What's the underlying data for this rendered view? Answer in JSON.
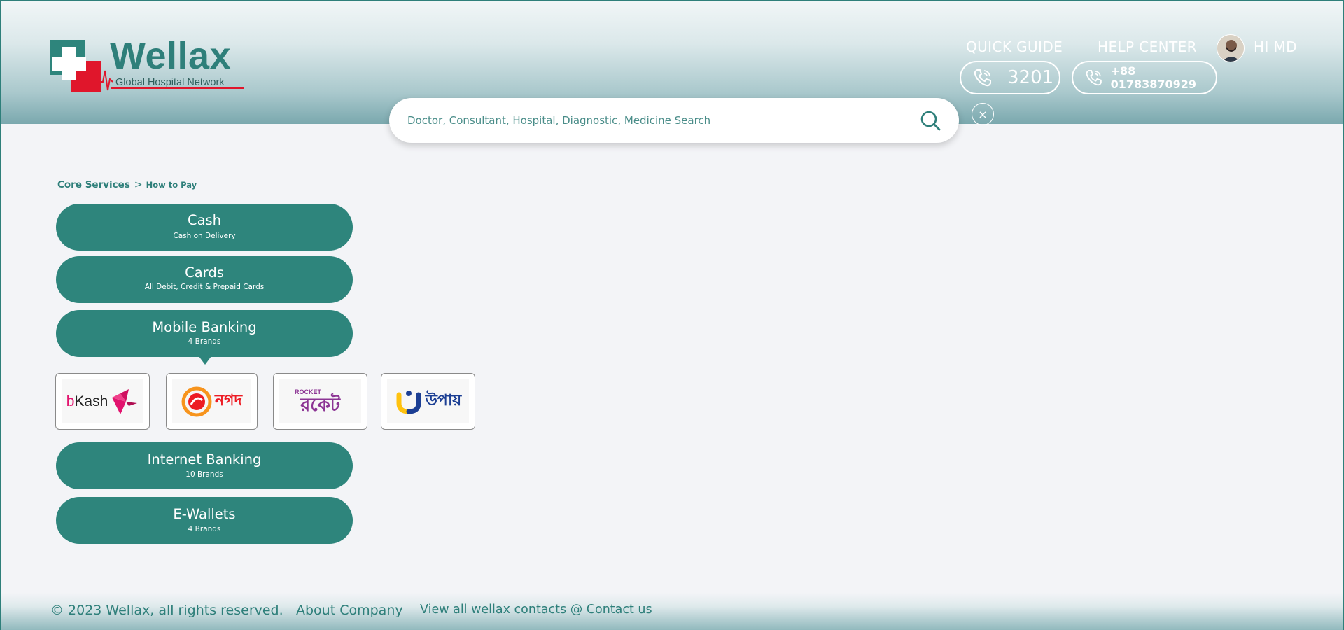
{
  "header": {
    "logo": {
      "name": "Wellax",
      "tagline": "Global Hospital Network"
    },
    "quick_guide": {
      "label": "QUICK GUIDE",
      "number": "3201"
    },
    "help_center": {
      "label": "HELP CENTER",
      "number": "+88 01783870929"
    },
    "user": {
      "greeting": "HI MD"
    },
    "search": {
      "placeholder": "Doctor, Consultant, Hospital, Diagnostic, Medicine Search",
      "value": "",
      "clear_label": "×"
    }
  },
  "breadcrumb": {
    "root": "Core Services",
    "separator": ">",
    "current": "How to Pay"
  },
  "payment_methods": [
    {
      "title": "Cash",
      "subtitle": "Cash on Delivery"
    },
    {
      "title": "Cards",
      "subtitle": "All Debit, Credit & Prepaid Cards"
    },
    {
      "title": "Mobile Banking",
      "subtitle": "4 Brands"
    },
    {
      "title": "Internet Banking",
      "subtitle": "10 Brands"
    },
    {
      "title": "E-Wallets",
      "subtitle": "4 Brands"
    }
  ],
  "mobile_brands": [
    {
      "name": "bKash",
      "logo_text_a": "b",
      "logo_text_b": "Kash"
    },
    {
      "name": "Nagad",
      "logo_text": "নগদ"
    },
    {
      "name": "Rocket",
      "logo_text_top": "ROCKET",
      "logo_text": "রকেট"
    },
    {
      "name": "Upay",
      "logo_text": "উপায়"
    }
  ],
  "footer": {
    "copyright": "© 2023 Wellax, all rights reserved.",
    "about": "About Company",
    "contacts": "View all wellax contacts @ Contact us"
  },
  "colors": {
    "primary": "#2e857c",
    "brand_teal": "#2e7f7a",
    "logo_red": "#e0162b"
  }
}
